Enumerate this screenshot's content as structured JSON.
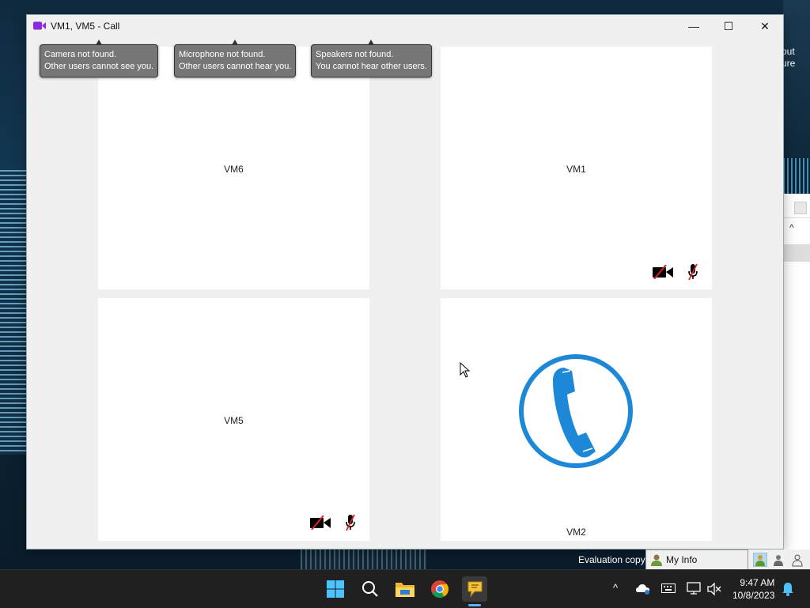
{
  "window": {
    "title": "VM1, VM5 - Call",
    "minimize_label": "—",
    "maximize_label": "☐",
    "close_label": "✕"
  },
  "tooltips": [
    {
      "line1": "Camera not found.",
      "line2": "Other users cannot see you."
    },
    {
      "line1": "Microphone not found.",
      "line2": "Other users cannot hear you."
    },
    {
      "line1": "Speakers not found.",
      "line2": "You cannot hear other users."
    }
  ],
  "participants": [
    {
      "name": "VM6",
      "camera_off": false,
      "mic_off": false
    },
    {
      "name": "VM1",
      "camera_off": true,
      "mic_off": true
    },
    {
      "name": "VM5",
      "camera_off": true,
      "mic_off": true
    },
    {
      "name": "VM2",
      "calling": true
    }
  ],
  "desktop": {
    "partial_text_1": "out",
    "partial_text_2": "ure",
    "evaluation_text": "Evaluation copy"
  },
  "statusbar": {
    "my_info_label": "My Info"
  },
  "taskbar": {
    "time": "9:47 AM",
    "date": "10/8/2023",
    "tray_chevron": "^"
  },
  "colors": {
    "call_blue": "#1e88d8",
    "app_purple": "#8a2be2"
  }
}
